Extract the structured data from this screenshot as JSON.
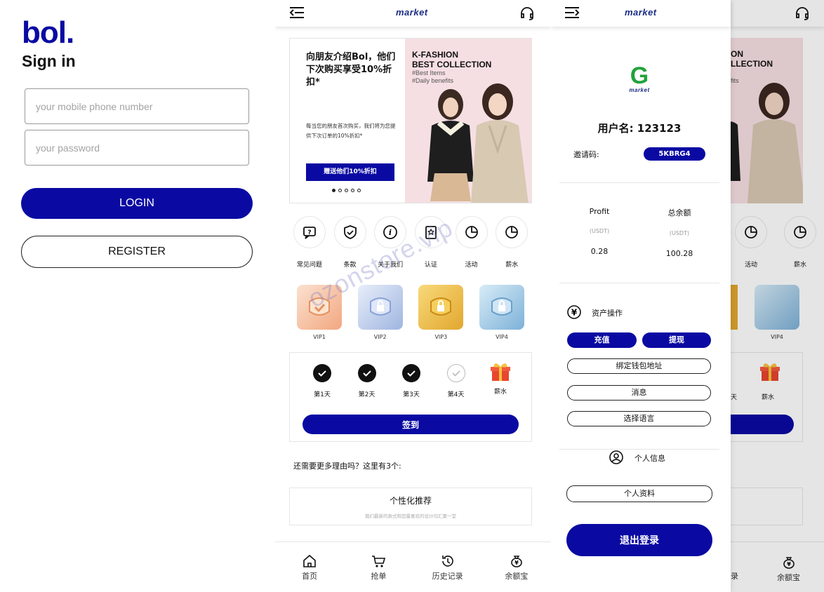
{
  "login": {
    "logo": "bol.",
    "title": "Sign in",
    "phone_placeholder": "your mobile phone number",
    "password_placeholder": "your password",
    "login_label": "LOGIN",
    "register_label": "REGISTER"
  },
  "home": {
    "brand": "market",
    "banner": {
      "headline": "向朋友介绍Bol，他们下次购买享受10%折扣*",
      "subtext": "每当您的朋友首次购买，我们将为您提供下次订单的10%折扣*",
      "button": "赠送他们10%折扣",
      "fashion_title_1": "K-FASHION",
      "fashion_title_2": "BEST COLLECTION",
      "fashion_tag_1": "#Best Items",
      "fashion_tag_2": "#Daily benefits"
    },
    "icons": [
      {
        "label": "常见问题"
      },
      {
        "label": "条款"
      },
      {
        "label": "关于我们"
      },
      {
        "label": "认证"
      },
      {
        "label": "活动"
      },
      {
        "label": "薪水"
      }
    ],
    "vips": [
      "VIP1",
      "VIP2",
      "VIP3",
      "VIP4"
    ],
    "checkin": {
      "days": [
        {
          "label": "第1天",
          "done": true
        },
        {
          "label": "第2天",
          "done": true
        },
        {
          "label": "第3天",
          "done": true
        },
        {
          "label": "第4天",
          "done": false
        },
        {
          "label": "薪水",
          "gift": true
        }
      ],
      "button": "签到"
    },
    "more_reasons": "还需要更多理由吗？这里有3个:",
    "card": {
      "title": "个性化推荐",
      "subtitle": "我们最新的款式和您最喜欢的设计均汇聚一堂"
    },
    "tabs": [
      "首页",
      "抢单",
      "历史记录",
      "余额宝"
    ],
    "watermark": "ozonstore.vip"
  },
  "drawer": {
    "brand": "market",
    "logo_letter": "G",
    "logo_sub": "market",
    "username": "用户名: 123123",
    "invite_label": "邀请码:",
    "invite_code": "5KBRG4",
    "stats": [
      {
        "title": "Profit",
        "unit": "(USDT)",
        "value": "0.28"
      },
      {
        "title": "总余额",
        "unit": "(USDT)",
        "value": "100.28"
      }
    ],
    "asset_section": "资产操作",
    "recharge": "充值",
    "withdraw": "提现",
    "bind_wallet": "绑定钱包地址",
    "messages": "消息",
    "language": "选择语言",
    "personal_section": "个人信息",
    "profile": "个人资料",
    "logout": "退出登录"
  },
  "background_peek": {
    "fashion_title_1": "ON",
    "fashion_title_2": "LLECTION",
    "fashion_tag": "fits",
    "icon_labels": [
      "活动",
      "薪水"
    ],
    "vip": "VIP4",
    "day_label": "天",
    "gift_label": "薪水",
    "tab_1": "录",
    "tab_2": "余额宝"
  },
  "colors": {
    "primary": "#0a0aa3",
    "brand": "#1a2c84",
    "logo_green": "#22a33a"
  }
}
